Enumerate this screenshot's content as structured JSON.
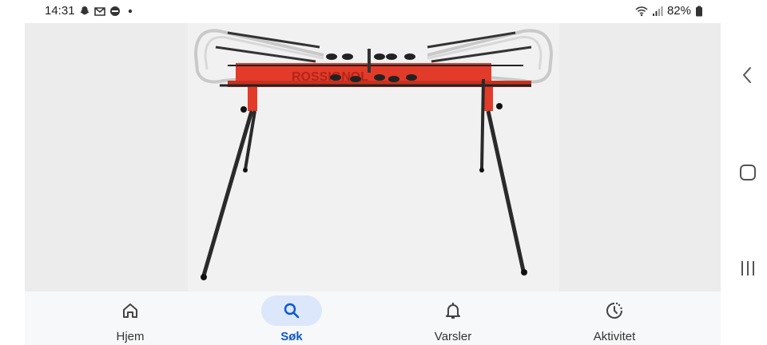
{
  "status_bar": {
    "time": "14:31",
    "left_icons": [
      "snapchat-icon",
      "gmail-icon",
      "app-icon",
      "dot-icon"
    ],
    "battery": "82%",
    "right_icons": [
      "wifi-icon",
      "signal-icon",
      "battery-icon"
    ]
  },
  "image": {
    "brand_text": "ROSSIGNOL",
    "background": "#ececec",
    "table_color": "#e23b2a",
    "leg_color": "#2a2a2a"
  },
  "bottom_nav": {
    "items": [
      {
        "label": "Hjem",
        "icon": "home-icon"
      },
      {
        "label": "Søk",
        "icon": "search-icon",
        "active": true
      },
      {
        "label": "Varsler",
        "icon": "bell-icon"
      },
      {
        "label": "Aktivitet",
        "icon": "activity-icon"
      }
    ],
    "active_color": "#0b57d0",
    "pill_color": "#dce7fb"
  },
  "system_nav": {
    "buttons": [
      "back-icon",
      "home-button-icon",
      "recents-icon"
    ]
  }
}
